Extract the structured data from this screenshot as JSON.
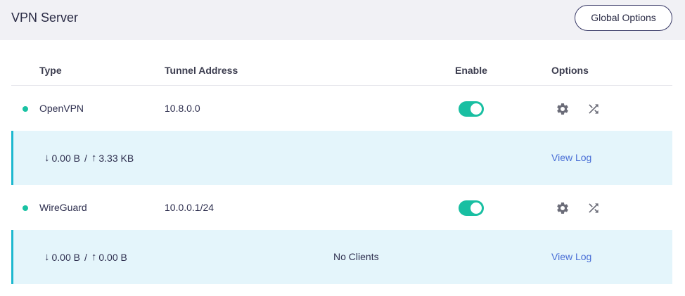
{
  "header": {
    "title": "VPN Server",
    "global_options_label": "Global Options"
  },
  "table": {
    "columns": {
      "type": "Type",
      "tunnel_address": "Tunnel Address",
      "enable": "Enable",
      "options": "Options"
    },
    "rows": [
      {
        "type": "OpenVPN",
        "tunnel_address": "10.8.0.0",
        "status_color": "#19c2a3",
        "enabled": true,
        "download": "0.00 B",
        "upload": "3.33 KB",
        "clients_text": "",
        "view_log_label": "View Log"
      },
      {
        "type": "WireGuard",
        "tunnel_address": "10.0.0.1/24",
        "status_color": "#19c2a3",
        "enabled": true,
        "download": "0.00 B",
        "upload": "0.00 B",
        "clients_text": "No Clients",
        "view_log_label": "View Log"
      }
    ]
  },
  "icons": {
    "settings": "gear-icon",
    "shuffle": "shuffle-icon",
    "download": "arrow-down-icon",
    "upload": "arrow-up-icon"
  },
  "glyphs": {
    "down_arrow": "↓",
    "up_arrow": "↑",
    "separator": "/"
  },
  "colors": {
    "accent_toggle": "#19bfa2",
    "row_highlight": "#e4f5fb",
    "link": "#4a6fd6",
    "border_accent": "#1db8cf"
  }
}
